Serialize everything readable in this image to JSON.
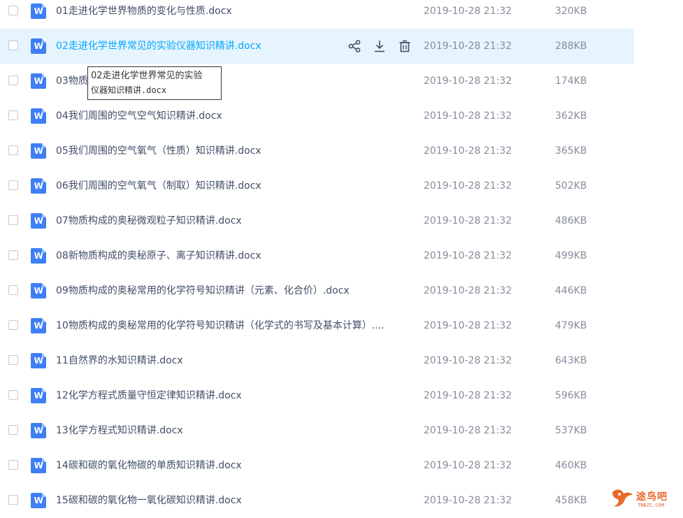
{
  "files": [
    {
      "name": "01走进化学世界物质的变化与性质.docx",
      "date": "2019-10-28 21:32",
      "size": "320KB",
      "icon": "word-doc-icon"
    },
    {
      "name": "02走进化学世界常见的实验仪器知识精讲.docx",
      "date": "2019-10-28 21:32",
      "size": "288KB",
      "icon": "word-doc-icon",
      "hovered": true
    },
    {
      "name": "03物质",
      "date": "2019-10-28 21:32",
      "size": "174KB",
      "icon": "word-doc-icon"
    },
    {
      "name": "04我们周围的空气空气知识精讲.docx",
      "date": "2019-10-28 21:32",
      "size": "362KB",
      "icon": "word-doc-icon"
    },
    {
      "name": "05我们周围的空气氧气（性质）知识精讲.docx",
      "date": "2019-10-28 21:32",
      "size": "365KB",
      "icon": "word-doc-icon"
    },
    {
      "name": "06我们周围的空气氧气（制取）知识精讲.docx",
      "date": "2019-10-28 21:32",
      "size": "502KB",
      "icon": "word-doc-icon"
    },
    {
      "name": "07物质构成的奥秘微观粒子知识精讲.docx",
      "date": "2019-10-28 21:32",
      "size": "486KB",
      "icon": "word-doc-icon"
    },
    {
      "name": "08新物质构成的奥秘原子、离子知识精讲.docx",
      "date": "2019-10-28 21:32",
      "size": "499KB",
      "icon": "word-doc-icon"
    },
    {
      "name": "09物质构成的奥秘常用的化学符号知识精讲（元素、化合价）.docx",
      "date": "2019-10-28 21:32",
      "size": "446KB",
      "icon": "word-doc-icon"
    },
    {
      "name": "10物质构成的奥秘常用的化学符号知识精讲（化学式的书写及基本计算）....",
      "date": "2019-10-28 21:32",
      "size": "479KB",
      "icon": "word-doc-icon"
    },
    {
      "name": "11自然界的水知识精讲.docx",
      "date": "2019-10-28 21:32",
      "size": "643KB",
      "icon": "word-doc-icon"
    },
    {
      "name": "12化学方程式质量守恒定律知识精讲.docx",
      "date": "2019-10-28 21:32",
      "size": "596KB",
      "icon": "word-doc-icon"
    },
    {
      "name": "13化学方程式知识精讲.docx",
      "date": "2019-10-28 21:32",
      "size": "537KB",
      "icon": "word-doc-icon"
    },
    {
      "name": "14碳和碳的氧化物碳的单质知识精讲.docx",
      "date": "2019-10-28 21:32",
      "size": "460KB",
      "icon": "word-doc-icon"
    },
    {
      "name": "15碳和碳的氧化物一氧化碳知识精讲.docx",
      "date": "2019-10-28 21:32",
      "size": "458KB",
      "icon": "word-doc-icon"
    }
  ],
  "file_icon_letter": "W",
  "hover_actions": [
    {
      "icon": "share-icon"
    },
    {
      "icon": "download-icon"
    },
    {
      "icon": "delete-icon"
    }
  ],
  "tooltip": {
    "line1": "02走进化学世界常见的实验",
    "line2": "仪器知识精讲.docx"
  },
  "watermark": {
    "text": "途鸟吧",
    "sub": "TNBZS.COM"
  },
  "colors": {
    "hover_row_bg": "#e6f4fd",
    "hover_text": "#06a7ff",
    "file_icon_blue": "#3e7ff5",
    "text_primary": "#424e67",
    "text_secondary": "#878c9c",
    "watermark": "#e8692c"
  }
}
